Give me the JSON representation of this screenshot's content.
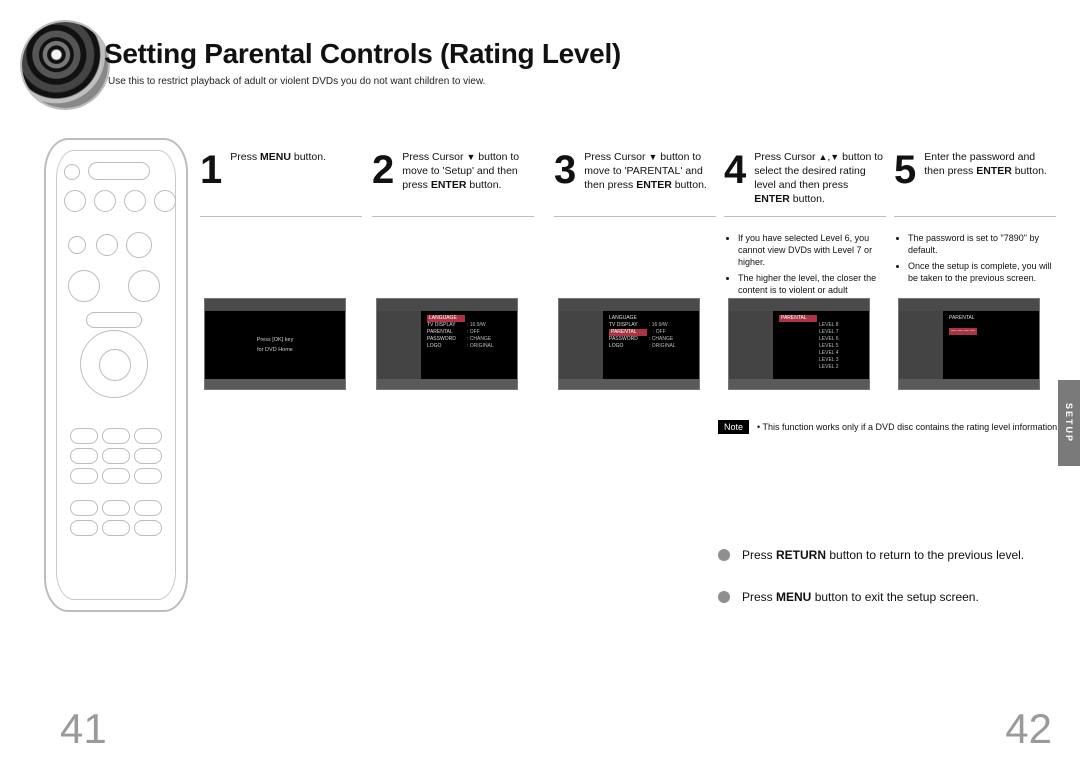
{
  "header": {
    "title": "Setting Parental Controls (Rating Level)",
    "subtitle": "Use this to restrict playback of adult or violent DVDs you do not want children to view."
  },
  "steps": [
    {
      "num": "1",
      "text_html": "Press <b>MENU</b> button.",
      "osd": {
        "kind": "menu",
        "lines": [
          "Press [OK] key",
          "for DVD Home"
        ]
      }
    },
    {
      "num": "2",
      "text_html": "Press Cursor <span class='tiny-arrow'>▼</span> button to move to 'Setup' and then press <b>ENTER</b> button.",
      "osd": {
        "kind": "list",
        "highlight": 0,
        "rows": [
          [
            "LANGUAGE",
            ""
          ],
          [
            "TV DISPLAY",
            ": 16:9/W"
          ],
          [
            "PARENTAL",
            ": OFF"
          ],
          [
            "PASSWORD",
            ": CHANGE"
          ],
          [
            "LOGO",
            ": ORIGINAL"
          ]
        ]
      }
    },
    {
      "num": "3",
      "text_html": "Press Cursor <span class='tiny-arrow'>▼</span> button to move to 'PARENTAL' and then press <b>ENTER</b> button.",
      "osd": {
        "kind": "list",
        "highlight": 2,
        "rows": [
          [
            "LANGUAGE",
            ""
          ],
          [
            "TV DISPLAY",
            ": 16:9/W"
          ],
          [
            "PARENTAL",
            ": OFF"
          ],
          [
            "PASSWORD",
            ": CHANGE"
          ],
          [
            "LOGO",
            ": ORIGINAL"
          ]
        ]
      }
    },
    {
      "num": "4",
      "text_html": "Press Cursor <span class='tiny-arrow'>▲</span>,<span class='tiny-arrow'>▼</span> button to select the desired rating level and then press <b>ENTER</b> button.",
      "bullets": [
        "If you have selected Level 6, you cannot view DVDs with Level 7 or higher.",
        "The higher the level, the closer the content is to violent or adult material."
      ],
      "osd": {
        "kind": "levels",
        "highlight": 0,
        "rows": [
          [
            "PARENTAL",
            ""
          ],
          [
            "",
            "LEVEL 8"
          ],
          [
            "",
            "LEVEL 7"
          ],
          [
            "",
            "LEVEL 6"
          ],
          [
            "",
            "LEVEL 5"
          ],
          [
            "",
            "LEVEL 4"
          ],
          [
            "",
            "LEVEL 3"
          ],
          [
            "",
            "LEVEL 2"
          ]
        ]
      }
    },
    {
      "num": "5",
      "text_html": "Enter the password and then press <b>ENTER</b> button.",
      "bullets": [
        "The password is set to \"7890\" by default.",
        "Once the setup is complete, you will be taken to the previous screen."
      ],
      "osd": {
        "kind": "password"
      }
    }
  ],
  "note": {
    "label": "Note",
    "text": "This function works only if a DVD disc contains the rating level information."
  },
  "instructions": {
    "return_html": "Press <b>RETURN</b> button to return to the previous level.",
    "menu_html": "Press <b>MENU</b> button to exit the setup screen."
  },
  "side_tab": "SETUP",
  "page_numbers": {
    "left": "41",
    "right": "42"
  }
}
